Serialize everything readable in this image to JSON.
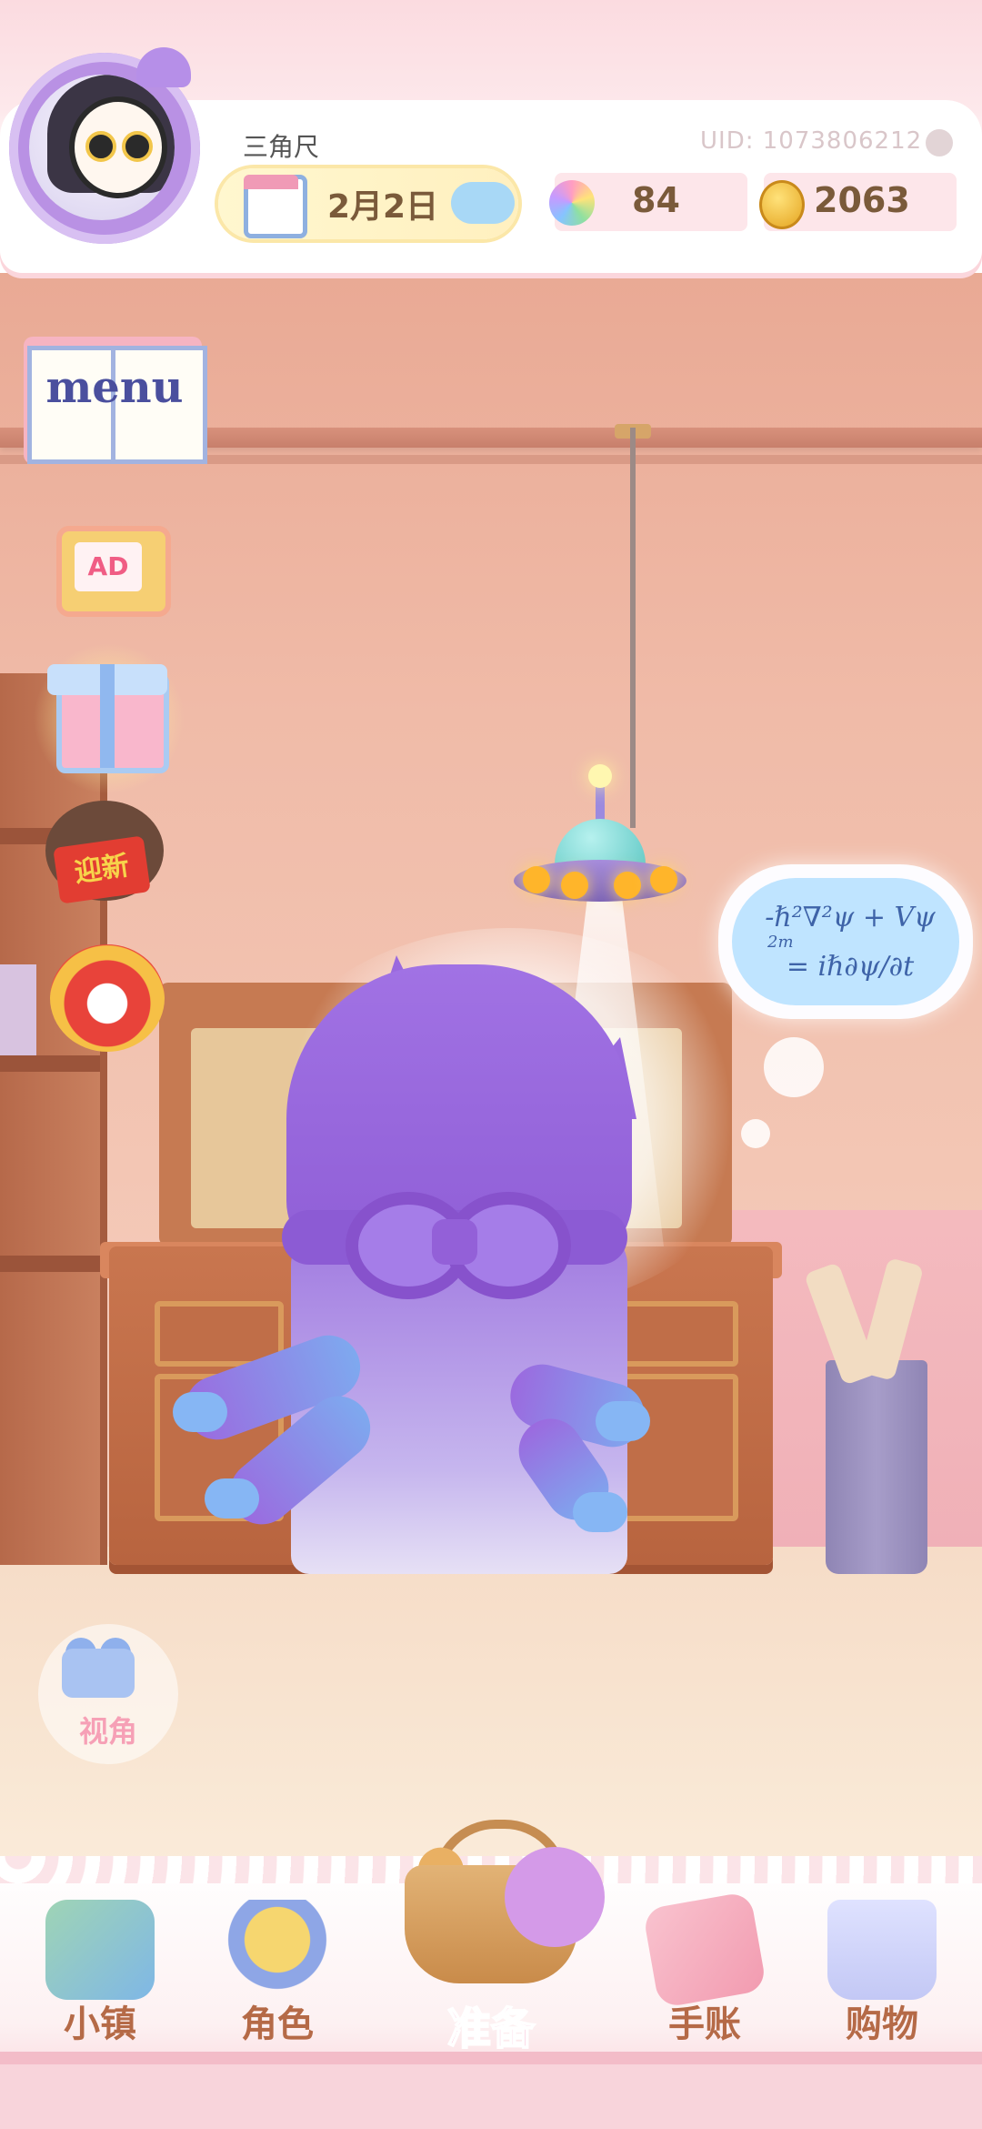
{
  "header": {
    "player_name": "三角尺",
    "uid": "UID: 1073806212",
    "date": "2月2日",
    "stars": "84",
    "coins": "2063"
  },
  "side_buttons": {
    "menu_label": "menu",
    "ad_label": "AD",
    "event_badge_label": "迎新"
  },
  "scene": {
    "thought_formula_line1": "-ℏ²∇²ψ + Vψ",
    "thought_formula_line2": "2m",
    "thought_formula_line3": "= iℏ∂ψ/∂t"
  },
  "view_button": {
    "label": "视角"
  },
  "nav": {
    "items": [
      {
        "label": "小镇"
      },
      {
        "label": "角色"
      },
      {
        "label": "准备"
      },
      {
        "label": "手账"
      },
      {
        "label": "购物"
      }
    ]
  },
  "colors": {
    "accent_pink": "#f59ac0",
    "nav_text": "#b56a47",
    "wall": "#f0bba8"
  }
}
